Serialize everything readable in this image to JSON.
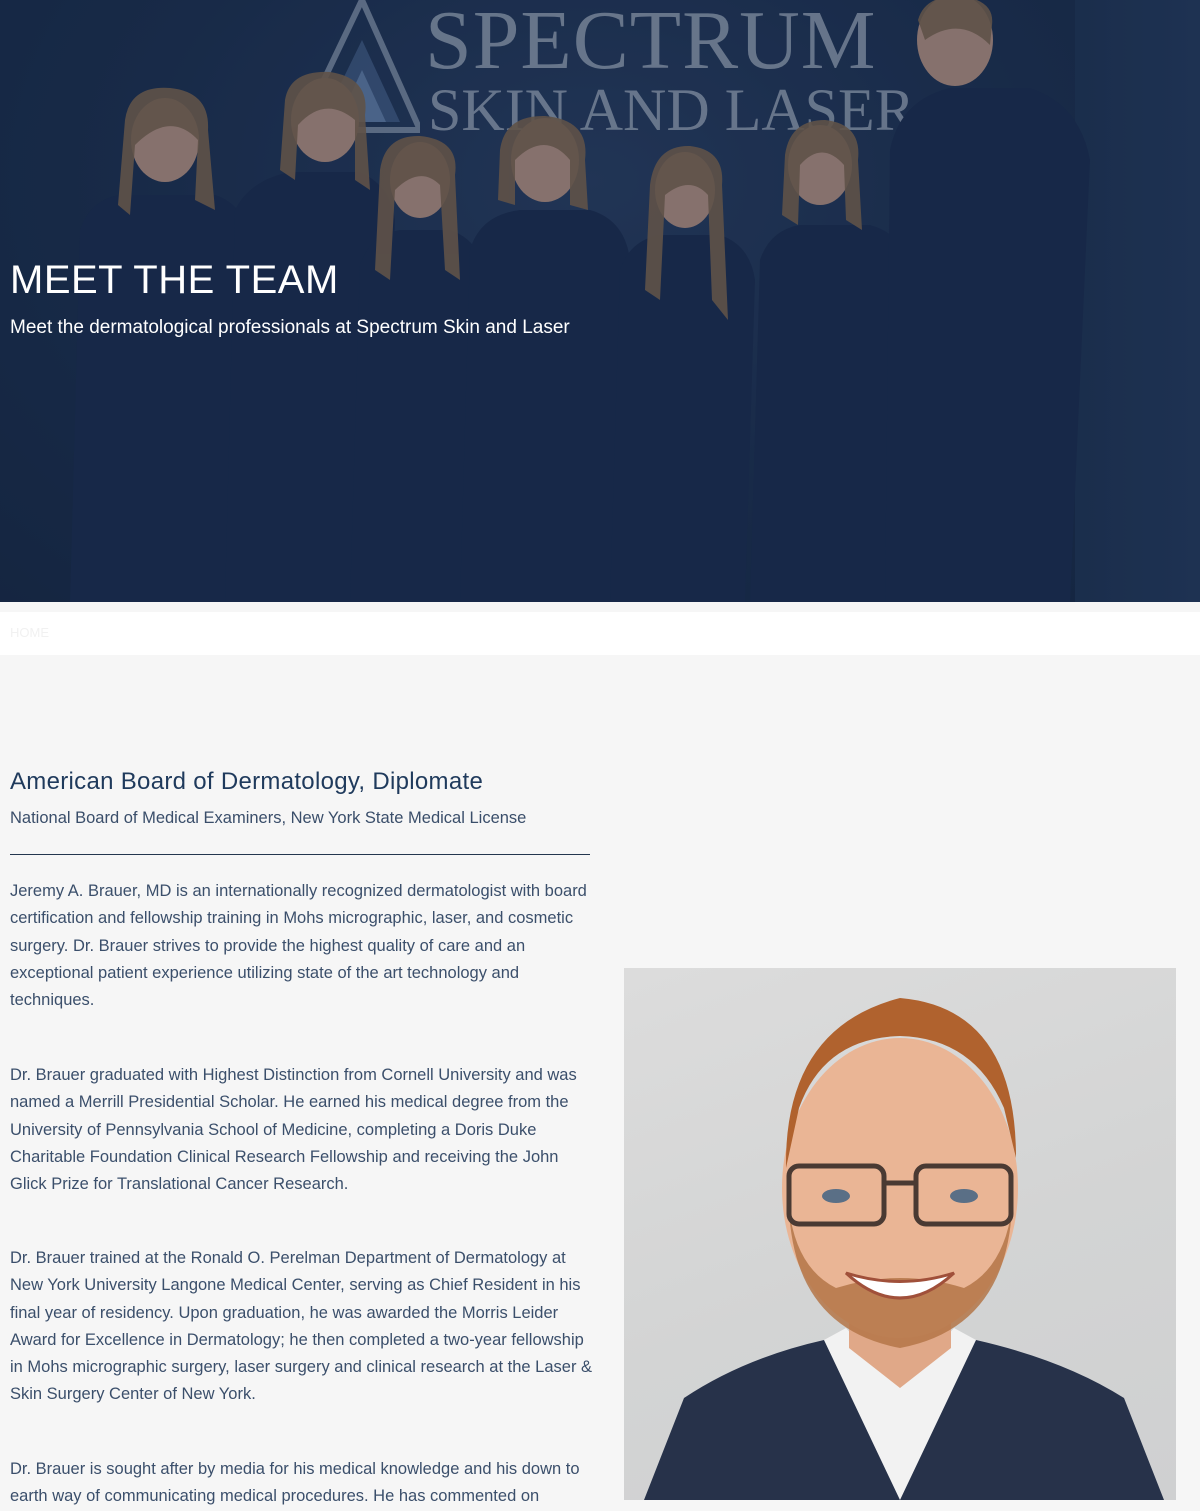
{
  "hero": {
    "title": "MEET THE TEAM",
    "subtitle": "Meet the dermatological professionals at Spectrum Skin and Laser",
    "logo_line1": "SPECTRUM",
    "logo_line2": "SKIN AND LASER"
  },
  "breadcrumb": {
    "home_label": "HOME"
  },
  "profile": {
    "credential_title": "American Board of Dermatology, Diplomate",
    "credential_subtitle": "National Board of Medical Examiners, New York State Medical License",
    "paragraphs": [
      "Jeremy A. Brauer, MD is an internationally recognized dermatologist with board certification and fellowship training in Mohs micrographic, laser, and cosmetic surgery. Dr. Brauer strives to provide the highest quality of care and an exceptional patient experience utilizing state of the art technology and techniques.",
      "Dr. Brauer graduated with Highest Distinction from Cornell University and was named a Merrill Presidential Scholar. He earned his medical degree from the University of Pennsylvania School of Medicine, completing a Doris Duke Charitable Foundation Clinical Research Fellowship and receiving the John Glick Prize for Translational Cancer Research.",
      "Dr. Brauer trained at the Ronald O. Perelman Department of Dermatology at New York University Langone Medical Center, serving as Chief Resident in his final year of residency. Upon graduation, he was awarded the Morris Leider Award for Excellence in Dermatology; he then completed a two-year fellowship in Mohs micrographic surgery, laser surgery and clinical research at the Laser & Skin Surgery Center of New York.",
      "Dr. Brauer is sought after by media for his medical knowledge and his down to earth way of communicating medical procedures. He has commented on"
    ]
  },
  "colors": {
    "hero_overlay": "#122646",
    "heading": "#1f3a5c",
    "body_text": "#3b4f6b",
    "page_background": "#f6f6f6"
  }
}
